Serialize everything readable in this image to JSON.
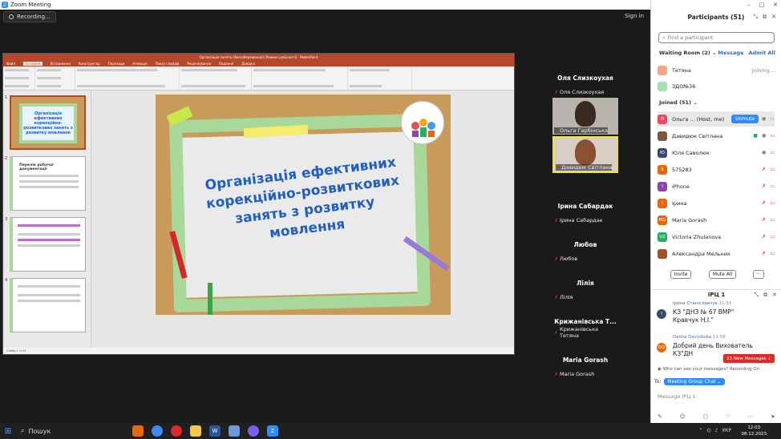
{
  "window": {
    "title": "Zoom Meeting",
    "controls": [
      "–",
      "□",
      "✕"
    ]
  },
  "toolbar": {
    "recording_label": "Recording...",
    "signin_label": "Sign in"
  },
  "ppt": {
    "title": "Організація занять (Автозбереження) [Режим сумісності] - PowerPoint",
    "tabs": [
      "Файл",
      "Основне",
      "Вставлення",
      "Конструктор",
      "Переходи",
      "Анімація",
      "Показ слайдів",
      "Рецензування",
      "Подання",
      "Довідка"
    ],
    "slide_title": "Організація ефективних корекційно-розвиткових занять з розвитку мовлення",
    "thumb1": "Організація ефективних корекційно-розвиткових занять з розвитку мовлення",
    "thumb2": "Перелік робочої документації",
    "thumb_numbers": [
      "1",
      "2",
      "3",
      "4"
    ],
    "status": "Слайд 1 із 54"
  },
  "gallery": [
    {
      "name": "Оля Слизкоухая",
      "label": "Оля Слизкоухая",
      "video": false
    },
    {
      "name": "",
      "label": "Ольга Гарбінська",
      "video": true
    },
    {
      "name": "",
      "label": "Давидюк Світлана",
      "video": true,
      "active": true
    },
    {
      "name": "Ірина Сабардак",
      "label": "Ірина Сабардак",
      "video": false
    },
    {
      "name": "Любов",
      "label": "Любов",
      "video": false
    },
    {
      "name": "Лілія",
      "label": "Лілія",
      "video": false
    },
    {
      "name": "Крижанівська Т...",
      "label": "Крижанівська Тетяна",
      "video": false
    },
    {
      "name": "Maria Gorash",
      "label": "Maria Gorash",
      "video": false
    }
  ],
  "participants": {
    "title": "Participants (51)",
    "search_placeholder": "Find a participant",
    "waiting_label": "Waiting Room (2)",
    "message_label": "Message",
    "admit_all_label": "Admit All",
    "waiting": [
      {
        "name": "Тетяна",
        "status": "Joining...",
        "color": "#f4a58a"
      },
      {
        "name": "ЗДО№36",
        "status": "",
        "color": "#a6e0b0"
      }
    ],
    "joined_label": "Joined (51)",
    "unmute_label": "Unmute",
    "joined": [
      {
        "initials": "О",
        "name": "Ольга ... (Host, me)",
        "color": "#e84a5f"
      },
      {
        "initials": "",
        "name": "Давидюк Світлана",
        "color": "#7a5a3a"
      },
      {
        "initials": "Ю",
        "name": "Юля Саволюк",
        "color": "#3a4a6a"
      },
      {
        "initials": "5",
        "name": "575283",
        "color": "#e8670c"
      },
      {
        "initials": "I",
        "name": "iPhone",
        "color": "#8e44ad"
      },
      {
        "initials": "I",
        "name": "Ірина",
        "color": "#e8670c"
      },
      {
        "initials": "MG",
        "name": "Maria Gorash",
        "color": "#e8670c"
      },
      {
        "initials": "VZ",
        "name": "Victoria Zhulanova",
        "color": "#27ae60"
      },
      {
        "initials": "",
        "name": "Александра Мельник",
        "color": "#a0522d"
      }
    ],
    "invite_label": "Invite",
    "mute_all_label": "Mute All",
    "more_label": "···"
  },
  "chat": {
    "title": "ІРЦ 1",
    "messages": [
      {
        "avatar": "I",
        "avatar_color": "#3a4a6a",
        "sender": "Ірина Станіславчук",
        "time": "11:55",
        "text": "КЗ \"ДНЗ № 67 ВМР\" Кравчук Н.І.\""
      },
      {
        "avatar": "DD",
        "avatar_color": "#e8670c",
        "sender": "Dasha Davydiuka",
        "time": "11:56",
        "text": "Добрий день Вихователь КЗ\"ДН"
      }
    ],
    "new_messages": "33 New Messages",
    "privacy_note": "Who can see your messages? Recording On",
    "to_label": "To:",
    "to_value": "Meeting Group Chat",
    "input_placeholder": "Message ІРЦ 1"
  },
  "taskbar": {
    "search_label": "Пошук",
    "lang": "УКР",
    "time": "12:03",
    "date": "08.12.2023"
  }
}
